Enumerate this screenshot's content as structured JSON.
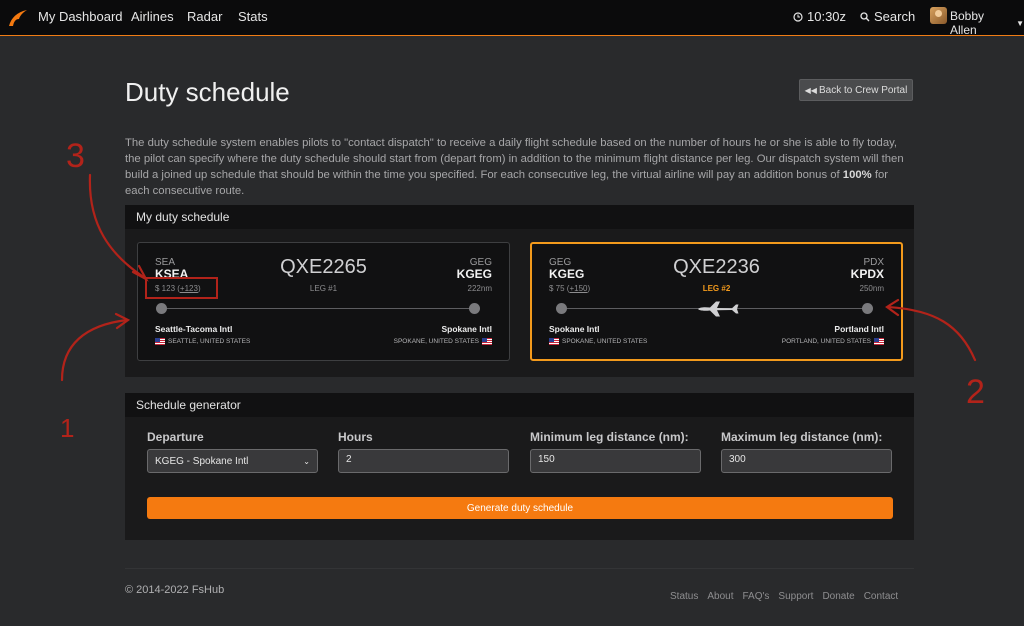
{
  "nav": {
    "brand": "My Dashboard",
    "links": [
      "Airlines",
      "Radar",
      "Stats"
    ],
    "clock": "10:30z",
    "search_label": "Search",
    "user_name": "Bobby Allen"
  },
  "header": {
    "title": "Duty schedule",
    "back_button": "Back to Crew Portal"
  },
  "intro": {
    "text_before": "The duty schedule system enables pilots to \"contact dispatch\" to receive a daily flight schedule based on the number of hours he or she is able to fly today, the pilot can specify where the duty schedule should start from (depart from) in addition to the minimum flight distance per leg. Our dispatch system will then build a joined up schedule that should be within the time you specified. For each consecutive leg, the virtual airline will pay an addition bonus of ",
    "bonus_pct": "100%",
    "text_after": " for each consecutive route."
  },
  "duty": {
    "panel_title": "My duty schedule",
    "legs": [
      {
        "dep_iata": "SEA",
        "dep_icao": "KSEA",
        "arr_iata": "GEG",
        "arr_icao": "KGEG",
        "flight": "QXE2265",
        "leg_label": "LEG #1",
        "price": "$ 123 (",
        "bonus": "+123",
        "price_close": ")",
        "distance": "222nm",
        "dep_name": "Seattle-Tacoma Intl",
        "dep_loc": "SEATTLE, UNITED STATES",
        "arr_name": "Spokane Intl",
        "arr_loc": "SPOKANE, UNITED STATES",
        "active": false
      },
      {
        "dep_iata": "GEG",
        "dep_icao": "KGEG",
        "arr_iata": "PDX",
        "arr_icao": "KPDX",
        "flight": "QXE2236",
        "leg_label": "LEG #2",
        "price": "$ 75 (",
        "bonus": "+150",
        "price_close": ")",
        "distance": "250nm",
        "dep_name": "Spokane Intl",
        "dep_loc": "SPOKANE, UNITED STATES",
        "arr_name": "Portland Intl",
        "arr_loc": "PORTLAND, UNITED STATES",
        "active": true
      }
    ]
  },
  "generator": {
    "panel_title": "Schedule generator",
    "departure_label": "Departure",
    "departure_value": "KGEG - Spokane Intl",
    "hours_label": "Hours",
    "hours_value": "2",
    "min_label": "Minimum leg distance (nm):",
    "min_value": "150",
    "max_label": "Maximum leg distance (nm):",
    "max_value": "300",
    "button": "Generate duty schedule"
  },
  "footer": {
    "copyright": "© 2014-2022 FsHub",
    "links": [
      "Status",
      "About",
      "FAQ's",
      "Support",
      "Donate",
      "Contact"
    ]
  },
  "annotations": {
    "numbers": [
      "3",
      "1",
      "2"
    ],
    "color": "#b2231a"
  },
  "colors": {
    "accent": "#f57a10",
    "active_leg_border": "#f39a1c"
  }
}
